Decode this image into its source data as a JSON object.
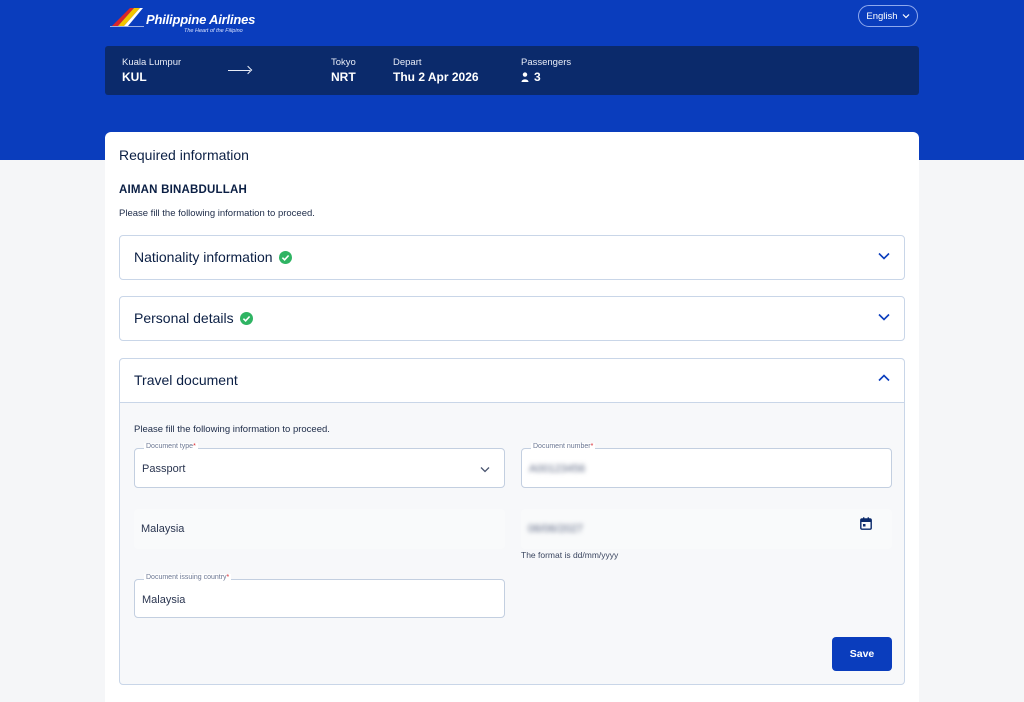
{
  "brand": {
    "name": "Philippine Airlines",
    "tagline": "The Heart of the Filipino"
  },
  "header": {
    "language": "English"
  },
  "flight": {
    "origin_city": "Kuala Lumpur",
    "origin_code": "KUL",
    "dest_city": "Tokyo",
    "dest_code": "NRT",
    "depart_label": "Depart",
    "depart_date": "Thu 2 Apr 2026",
    "passengers_label": "Passengers",
    "passengers_count": "3"
  },
  "card": {
    "title": "Required information",
    "passenger_name": "AIMAN BINABDULLAH",
    "instruction": "Please fill the following information to proceed."
  },
  "sections": {
    "nationality": {
      "title": "Nationality information",
      "complete": true
    },
    "personal": {
      "title": "Personal details",
      "complete": true
    },
    "travel": {
      "title": "Travel document",
      "instruction": "Please fill the following information to proceed.",
      "document_type_label": "Document type",
      "document_type_value": "Passport",
      "document_number_label": "Document number",
      "document_number_value": "A00123456",
      "nationality_value": "Malaysia",
      "expiry_value": "06/06/2027",
      "date_format_hint": "The format is dd/mm/yyyy",
      "issuing_country_label": "Document issuing country",
      "issuing_country_value": "Malaysia",
      "save_label": "Save"
    }
  },
  "colors": {
    "brand_blue": "#0a3dbd",
    "navy": "#0b2a6b",
    "success_green": "#2fb463",
    "required_red": "#d9242b"
  }
}
